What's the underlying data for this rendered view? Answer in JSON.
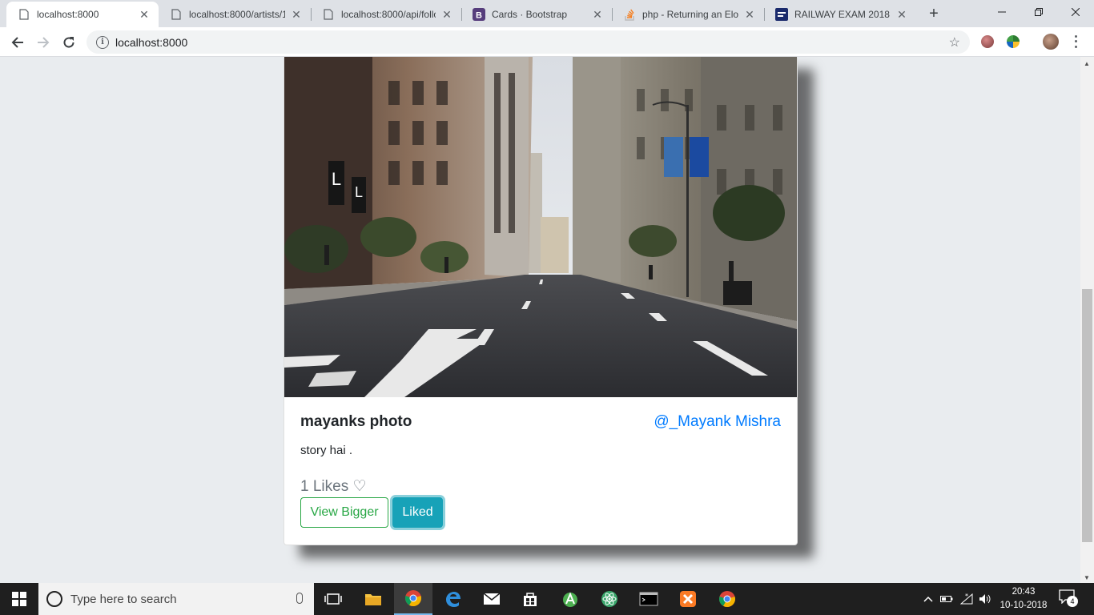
{
  "browser": {
    "tabs": [
      {
        "title": "localhost:8000",
        "icon": "page-icon",
        "active": true
      },
      {
        "title": "localhost:8000/artists/1",
        "icon": "page-icon",
        "active": false
      },
      {
        "title": "localhost:8000/api/follo",
        "icon": "page-icon",
        "active": false
      },
      {
        "title": "Cards · Bootstrap",
        "icon": "bootstrap-icon",
        "active": false
      },
      {
        "title": "php - Returning an Eloq",
        "icon": "stackoverflow-icon",
        "active": false
      },
      {
        "title": "RAILWAY EXAM 2018. L",
        "icon": "site-icon",
        "active": false
      }
    ],
    "url": "localhost:8000"
  },
  "card": {
    "title": "mayanks photo",
    "author": "@_Mayank Mishra",
    "text": "story hai .",
    "likes_label": "1 Likes ♡",
    "view_button": "View Bigger",
    "liked_button": "Liked"
  },
  "taskbar": {
    "search_placeholder": "Type here to search",
    "time": "20:43",
    "date": "10-10-2018",
    "notification_count": "4"
  },
  "colors": {
    "primary": "#007bff",
    "success": "#28a745",
    "info": "#17a2b8"
  }
}
